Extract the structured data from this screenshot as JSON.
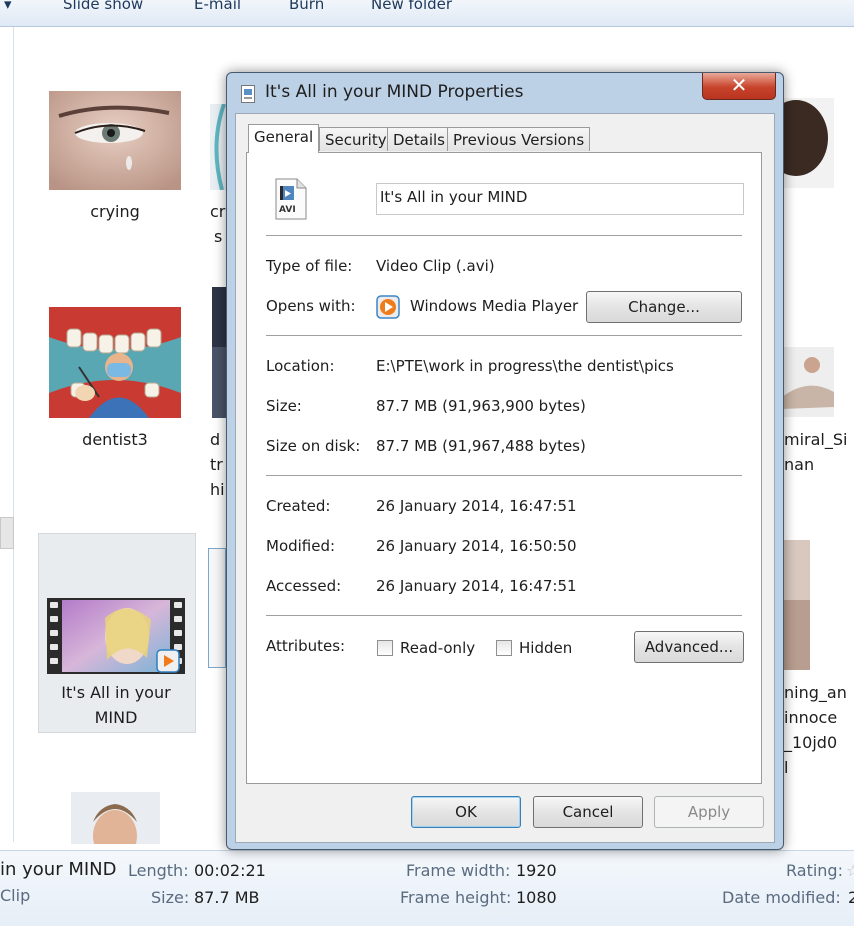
{
  "toolbar": {
    "items": [
      "Slide show",
      "E-mail",
      "Burn",
      "New folder"
    ]
  },
  "files": {
    "captions": {
      "crying": "crying",
      "cr_partial_1": "cr",
      "cr_partial_2": "s",
      "dentist3": "dentist3",
      "d_partial_1": "d",
      "d_partial_2": "tr",
      "d_partial_3": "hi",
      "mind_line1": "It's All in your",
      "mind_line2": "MIND",
      "right1_line1": "miral_Si",
      "right1_line2": "nan",
      "right2_line1": "ning_an",
      "right2_line2": "innoce",
      "right2_line3": "_10jd0",
      "right2_line4": "l"
    }
  },
  "statusbar": {
    "name": "in your MIND",
    "type": "Clip",
    "length_label": "Length:",
    "length_value": "00:02:21",
    "size_label": "Size:",
    "size_value": "87.7 MB",
    "frame_width_label": "Frame width:",
    "frame_width_value": "1920",
    "frame_height_label": "Frame height:",
    "frame_height_value": "1080",
    "rating_label": "Rating:",
    "date_modified_label": "Date modified:",
    "date_modified_value": "2"
  },
  "dialog": {
    "title": "It's All in your MIND Properties",
    "close_label": "✕",
    "tabs": [
      "General",
      "Security",
      "Details",
      "Previous Versions"
    ],
    "file_name": "It's All in your MIND",
    "file_icon_label": "AVI",
    "type_label": "Type of file:",
    "type_value": "Video Clip (.avi)",
    "opens_label": "Opens with:",
    "opens_value": "Windows Media Player",
    "change_button": "Change...",
    "location_label": "Location:",
    "location_value": "E:\\PTE\\work in progress\\the dentist\\pics",
    "size_label": "Size:",
    "size_value": "87.7 MB (91,963,900 bytes)",
    "size_on_disk_label": "Size on disk:",
    "size_on_disk_value": "87.7 MB (91,967,488 bytes)",
    "created_label": "Created:",
    "created_value": "26 January 2014, 16:47:51",
    "modified_label": "Modified:",
    "modified_value": "26 January 2014, 16:50:50",
    "accessed_label": "Accessed:",
    "accessed_value": "26 January 2014, 16:47:51",
    "attributes_label": "Attributes:",
    "readonly_label": "Read-only",
    "hidden_label": "Hidden",
    "advanced_button": "Advanced...",
    "ok_button": "OK",
    "cancel_button": "Cancel",
    "apply_button": "Apply"
  }
}
